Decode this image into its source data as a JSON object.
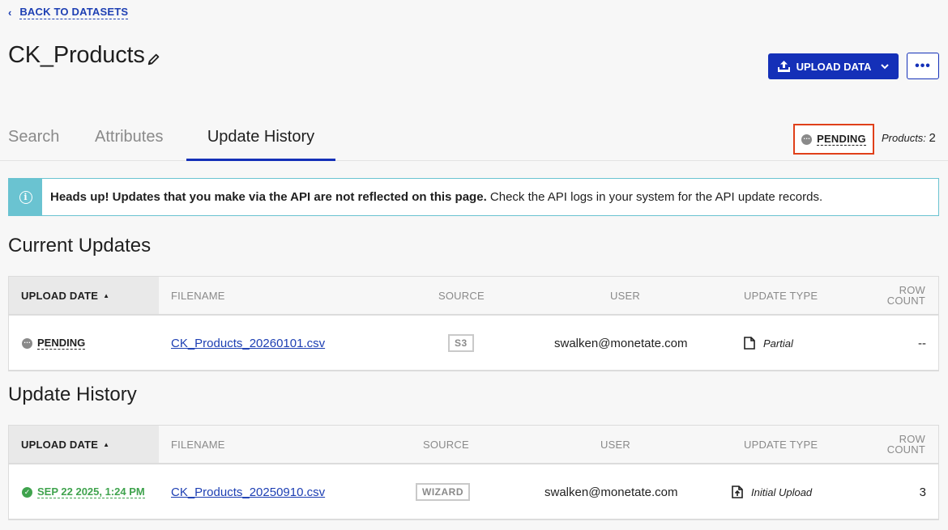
{
  "nav": {
    "back_label": "BACK TO DATASETS"
  },
  "header": {
    "title": "CK_Products",
    "upload_label": "UPLOAD DATA",
    "more_label": "•••"
  },
  "tabs": [
    {
      "label": "Search"
    },
    {
      "label": "Attributes"
    },
    {
      "label": "Update History"
    }
  ],
  "status": {
    "label": "PENDING",
    "products_label": "Products:",
    "products_count": "2"
  },
  "banner": {
    "bold": "Heads up! Updates that you make via the API are not reflected on this page.",
    "rest": " Check the API logs in your system for the API update records."
  },
  "columns": {
    "upload_date": "UPLOAD DATE",
    "filename": "FILENAME",
    "source": "SOURCE",
    "user": "USER",
    "update_type": "UPDATE TYPE",
    "row_count_1": "ROW",
    "row_count_2": "COUNT"
  },
  "current": {
    "title": "Current Updates",
    "row": {
      "status": "PENDING",
      "filename": "CK_Products_20260101.csv",
      "source": "S3",
      "user": "swalken@monetate.com",
      "update_type": "Partial",
      "row_count": "--"
    }
  },
  "history": {
    "title": "Update History",
    "row": {
      "date": "SEP 22 2025, 1:24 PM",
      "filename": "CK_Products_20250910.csv",
      "source": "WIZARD",
      "user": "swalken@monetate.com",
      "update_type": "Initial Upload",
      "row_count": "3"
    }
  },
  "colors": {
    "accent": "#1430b8",
    "link": "#1d3fb3",
    "success": "#3fa34d",
    "info": "#6ac3d1",
    "highlight": "#e0401a"
  }
}
